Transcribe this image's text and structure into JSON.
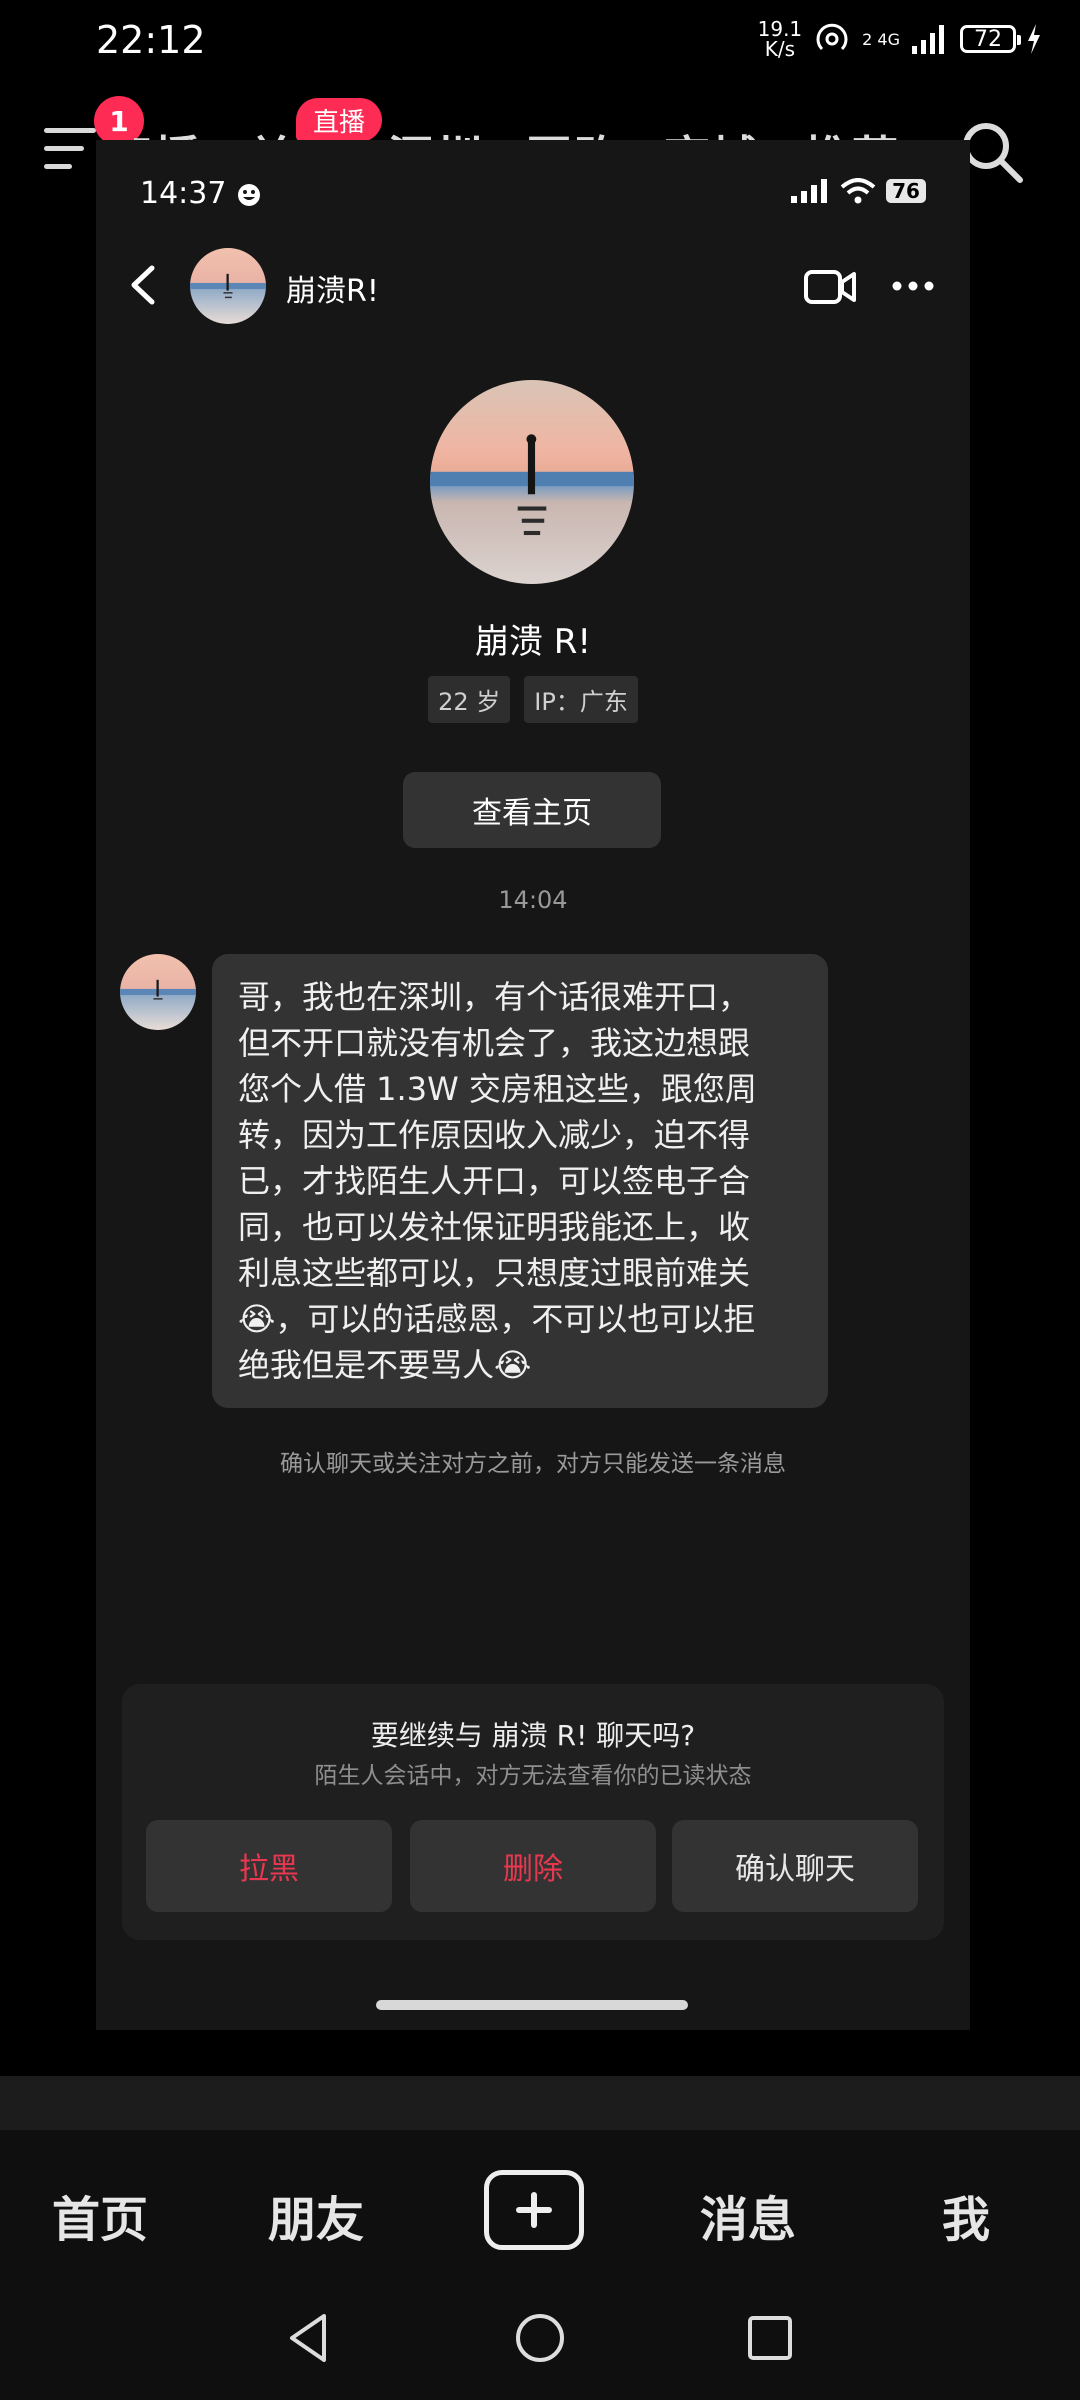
{
  "status_bar": {
    "time": "22:12",
    "net_speed_value": "19.1",
    "net_speed_unit": "K/s",
    "signal_label": "2 4G",
    "battery": "72"
  },
  "top_nav": {
    "notification_count": "1",
    "tabs": [
      "直播",
      "关注",
      "深圳",
      "团购",
      "商城",
      "推荐"
    ],
    "live_badge": "直播"
  },
  "inner_status": {
    "time": "14:37",
    "battery": "76"
  },
  "chat": {
    "contact_name": "崩溃R!",
    "profile_name": "崩溃 R!",
    "age_tag": "22 岁",
    "ip_tag": "IP：广东",
    "view_home_button": "查看主页",
    "timestamp": "14:04",
    "message_lines": [
      "哥，我也在深圳，有个话很难开口，",
      "但不开口就没有机会了，我这边想跟",
      "您个人借 1.3W 交房租这些，跟您周",
      "转，因为工作原因收入减少，迫不得",
      "已，才找陌生人开口，可以签电子合",
      "同，也可以发社保证明我能还上，收",
      "利息这些都可以，只想度过眼前难关",
      "😭，可以的话感恩，不可以也可以拒",
      "绝我但是不要骂人😭"
    ],
    "notice": "确认聊天或关注对方之前，对方只能发送一条消息"
  },
  "confirm": {
    "title": "要继续与 崩溃 R!  聊天吗?",
    "subtitle": "陌生人会话中，对方无法查看你的已读状态",
    "block_button": "拉黑",
    "delete_button": "删除",
    "confirm_button": "确认聊天"
  },
  "bottom_nav": {
    "home": "首页",
    "friends": "朋友",
    "messages": "消息",
    "me": "我"
  },
  "colors": {
    "accent_red": "#fe2c55",
    "danger_text": "#e8384f"
  }
}
